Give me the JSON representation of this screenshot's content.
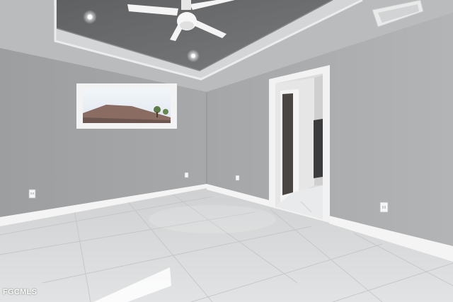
{
  "watermark": {
    "text": "FGCMLS"
  },
  "palette": {
    "ceiling": "#b7b9bb",
    "tray": "#6f7072",
    "left_wall": "#a0a2a4",
    "right_wall": "#aeb0b2",
    "floor": "#d9dadb",
    "baseboard": "#f4f4f4",
    "trim": "#f2f2f2"
  },
  "icons": [
    "ceiling-fan-icon",
    "recessed-light-icon",
    "air-vent-icon",
    "electrical-outlet-icon"
  ]
}
